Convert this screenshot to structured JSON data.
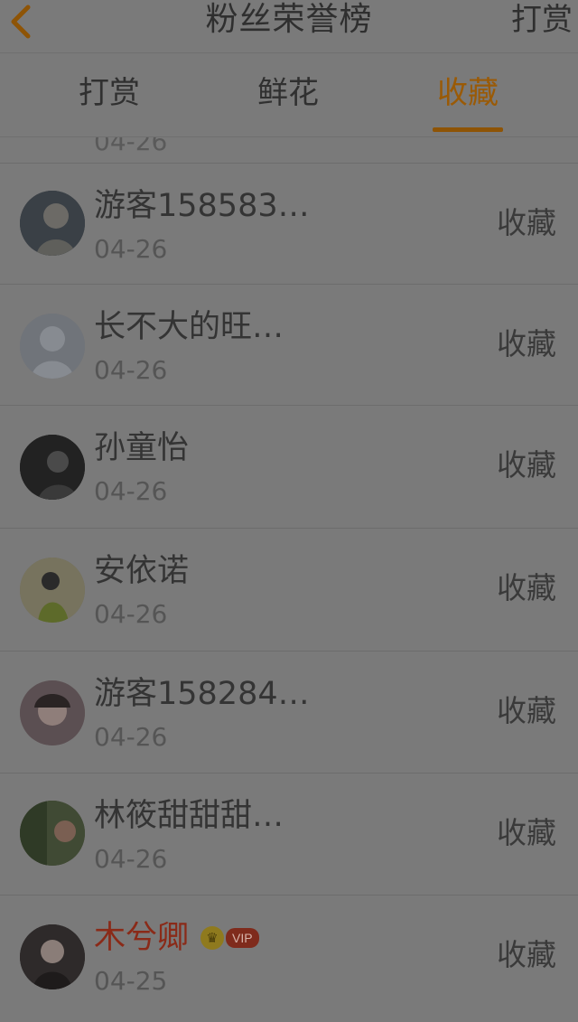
{
  "header": {
    "title": "粉丝荣誉榜",
    "right_label": "打赏",
    "back_icon": "chevron-left-icon"
  },
  "tabs": [
    {
      "label": "打赏",
      "active": false
    },
    {
      "label": "鲜花",
      "active": false
    },
    {
      "label": "收藏",
      "active": true
    }
  ],
  "colors": {
    "active_tab": "#9a5a06",
    "vip_name": "#8a2a18",
    "back_icon": "#8e5406"
  },
  "partial_row": {
    "date": "04-26"
  },
  "rows": [
    {
      "name": "游客158583…",
      "date": "04-26",
      "action": "收藏",
      "avatar": "avatar-icon"
    },
    {
      "name": "长不大的旺…",
      "date": "04-26",
      "action": "收藏",
      "avatar": "default-avatar-icon"
    },
    {
      "name": "孙童怡",
      "date": "04-26",
      "action": "收藏",
      "avatar": "avatar-icon"
    },
    {
      "name": "安依诺",
      "date": "04-26",
      "action": "收藏",
      "avatar": "avatar-icon"
    },
    {
      "name": "游客158284…",
      "date": "04-26",
      "action": "收藏",
      "avatar": "avatar-icon"
    },
    {
      "name": "林筱甜甜甜…",
      "date": "04-26",
      "action": "收藏",
      "avatar": "avatar-icon"
    },
    {
      "name": "木兮卿",
      "date": "04-25",
      "action": "收藏",
      "avatar": "avatar-icon",
      "vip": true,
      "vip_label": "VIP",
      "crown_icon": "crown-icon"
    }
  ]
}
